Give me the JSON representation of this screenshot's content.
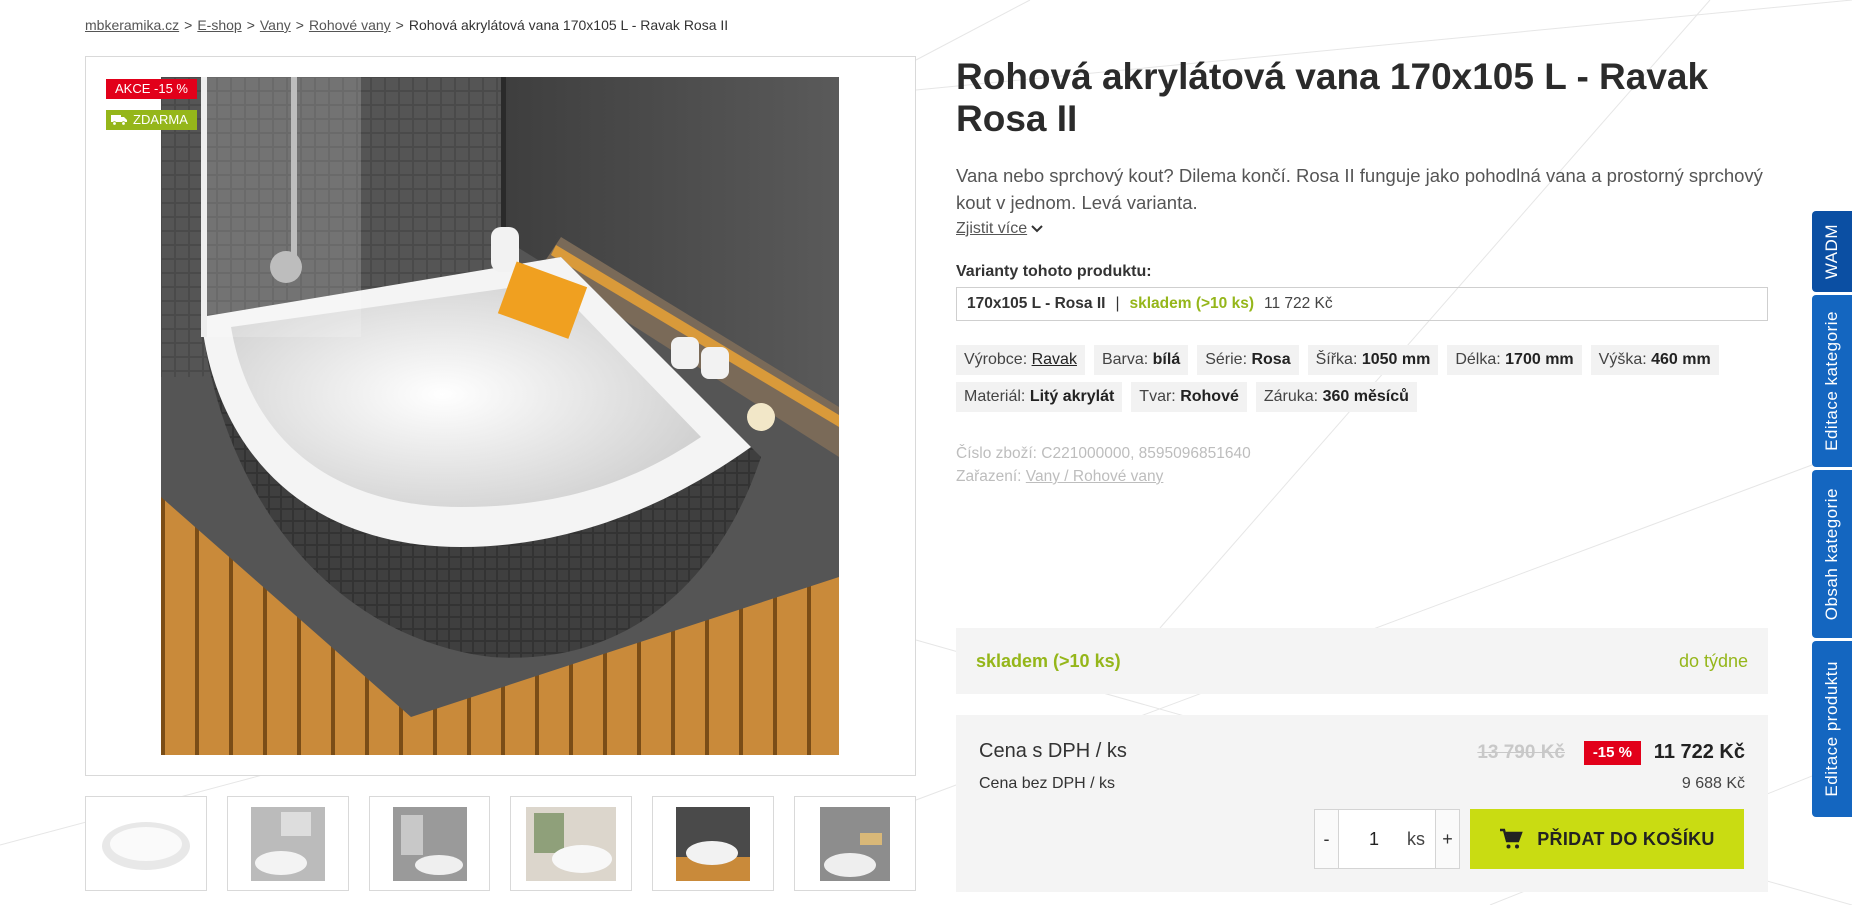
{
  "breadcrumb": {
    "items": [
      "mbkeramika.cz",
      "E-shop",
      "Vany",
      "Rohové vany"
    ],
    "current": "Rohová akrylátová vana 170x105 L - Ravak Rosa II",
    "separator": ">"
  },
  "badges": {
    "sale_prefix": "AKCE",
    "sale_value": "-15 %",
    "free": "ZDARMA",
    "free_icon": "truck-icon"
  },
  "thumbnails": [
    "thumb-1",
    "thumb-2",
    "thumb-3",
    "thumb-4",
    "thumb-5",
    "thumb-6"
  ],
  "product": {
    "title": "Rohová akrylátová vana 170x105 L - Ravak Rosa II",
    "description": "Vana nebo sprchový kout? Dilema končí. Rosa II funguje jako pohodlná vana a prostorný sprchový kout v jednom. Levá varianta.",
    "more_link": "Zjistit více",
    "variants_label": "Varianty tohoto produktu:",
    "variant": {
      "name": "170x105 L - Rosa II",
      "separator": "|",
      "stock": "skladem (>10 ks)",
      "price": "11 722 Kč"
    },
    "params": [
      {
        "label": "Výrobce:",
        "value": "Ravak",
        "link": true
      },
      {
        "label": "Barva:",
        "value": "bílá"
      },
      {
        "label": "Série:",
        "value": "Rosa"
      },
      {
        "label": "Šířka:",
        "value": "1050 mm"
      },
      {
        "label": "Délka:",
        "value": "1700 mm"
      },
      {
        "label": "Výška:",
        "value": "460 mm"
      },
      {
        "label": "Materiál:",
        "value": "Litý akrylát"
      },
      {
        "label": "Tvar:",
        "value": "Rohové"
      },
      {
        "label": "Záruka:",
        "value": "360 měsíců"
      }
    ],
    "code_label": "Číslo zboží:",
    "code_value": "C221000000, 8595096851640",
    "category_label": "Zařazení:",
    "category_value": "Vany / Rohové vany"
  },
  "stock_box": {
    "status": "skladem (>10 ks)",
    "delivery": "do týdne"
  },
  "price": {
    "with_vat_label": "Cena s DPH / ks",
    "without_vat_label": "Cena bez DPH / ks",
    "old": "13 790 Kč",
    "discount": "-15 %",
    "current": "11 722 Kč",
    "net": "9 688 Kč"
  },
  "cart": {
    "minus": "-",
    "plus": "+",
    "quantity": "1",
    "unit": "ks",
    "button": "PŘIDAT DO KOŠÍKU",
    "icon": "cart-icon"
  },
  "side_tabs": [
    "WADM",
    "Editace kategorie",
    "Obsah kategorie",
    "Editace produktu"
  ],
  "colors": {
    "accent_green": "#95b61a",
    "cart_button": "#c9dc12",
    "sale_red": "#e2001a",
    "admin_blue": "#1466c0"
  }
}
